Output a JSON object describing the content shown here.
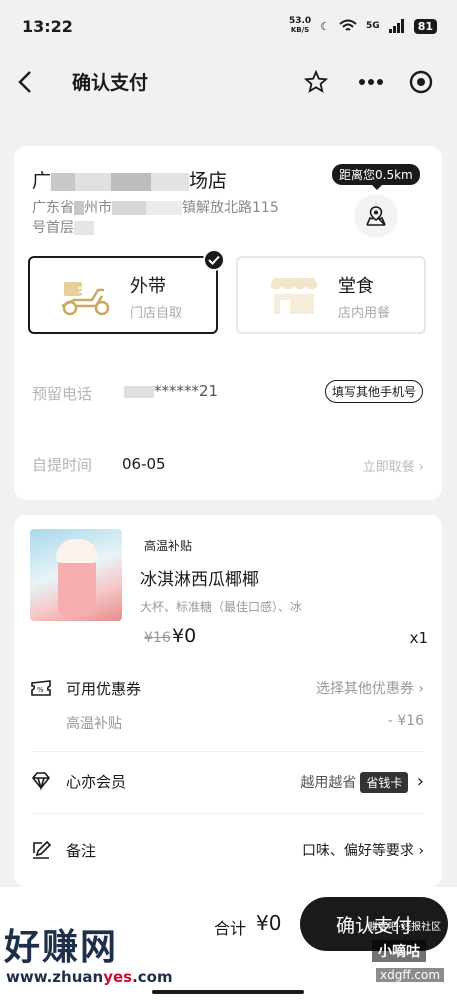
{
  "status_bar": {
    "time": "13:22",
    "speed_top": "53.0",
    "speed_unit": "KB/S",
    "signal": "5G",
    "battery": "81"
  },
  "header": {
    "title": "确认支付"
  },
  "store": {
    "name_prefix": "广",
    "name_suffix": "场店",
    "address_prefix": "广东省",
    "address_mid": "州市",
    "address_suffix": "镇解放北路115",
    "address_line2": "号首层",
    "distance": "距离您0.5km"
  },
  "order_mode": {
    "takeout_label": "外带",
    "takeout_sub": "门店自取",
    "dinein_label": "堂食",
    "dinein_sub": "店内用餐"
  },
  "phone": {
    "label": "预留电话",
    "value": "******21",
    "action": "填写其他手机号"
  },
  "pickup": {
    "label": "自提时间",
    "value": "06-05",
    "action": "立即取餐 ›"
  },
  "item": {
    "tag": "高温补贴",
    "name": "冰淇淋西瓜椰椰",
    "spec": "大杯、标准糖（最佳口感）、冰",
    "original_price": "¥16",
    "price": "¥0",
    "quantity": "x1"
  },
  "coupon": {
    "label": "可用优惠券",
    "action": "选择其他优惠券 ›",
    "sub_label": "高温补贴",
    "sub_value": "- ¥16"
  },
  "member": {
    "label": "心亦会员",
    "text": "越用越省",
    "badge": "省钱卡",
    "chevron": "›"
  },
  "remark": {
    "label": "备注",
    "hint": "口味、偏好等要求 ›"
  },
  "footer": {
    "total_label": "合计",
    "total_value": "¥0",
    "pay_button": "确认支付"
  },
  "watermark": {
    "big": "好赚网",
    "url_a": "www.zhuan",
    "url_b": "yes",
    "url_c": ".com",
    "side0": "赚客吧·线报社区",
    "side1": "小嘀咕",
    "side2": "xdgff.com"
  }
}
